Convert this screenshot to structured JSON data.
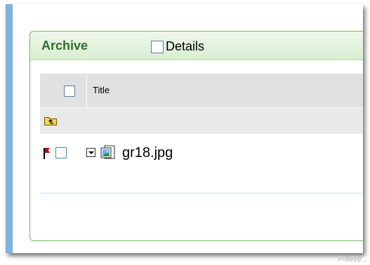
{
  "panel": {
    "title": "Archive",
    "details_label": "Details"
  },
  "table": {
    "columns": [
      "Title"
    ]
  },
  "rows": [
    {
      "name": "gr18.jpg",
      "flagged": true,
      "checked": false
    }
  ],
  "icons": {
    "up_folder": "folder-up-icon",
    "flag": "red-flag-icon",
    "expand": "dropdown-toggle-icon",
    "file": "image-file-icon"
  },
  "colors": {
    "panel_border": "#6bbd5b",
    "title_text": "#2e6e2a",
    "flag": "#d40000"
  },
  "watermark": ">>freetr..."
}
